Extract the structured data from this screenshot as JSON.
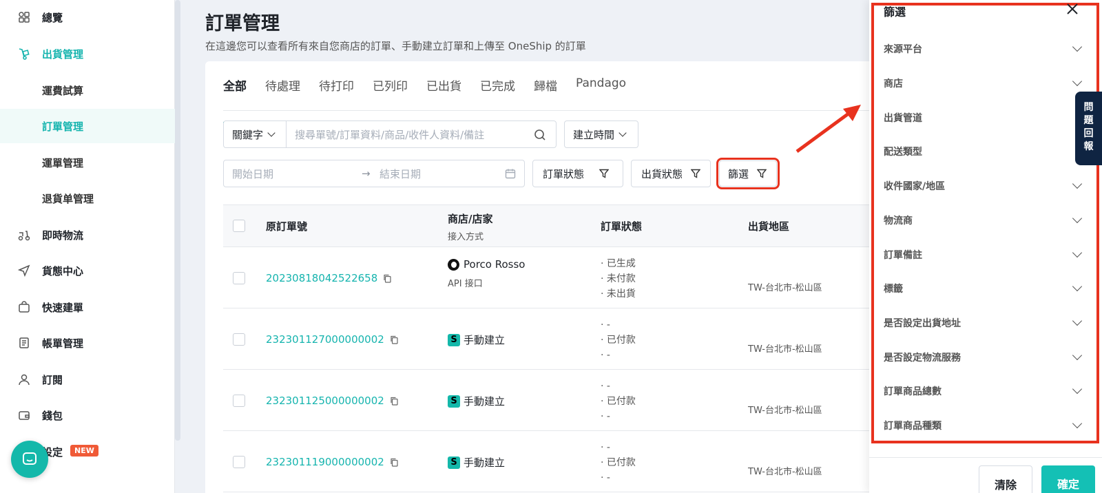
{
  "sidebar": {
    "items": [
      {
        "label": "總覽"
      },
      {
        "label": "出貨管理"
      },
      {
        "label": "運費試算"
      },
      {
        "label": "訂單管理"
      },
      {
        "label": "運單管理"
      },
      {
        "label": "退貨单管理"
      },
      {
        "label": "即時物流"
      },
      {
        "label": "貨態中心"
      },
      {
        "label": "快速建單"
      },
      {
        "label": "帳單管理"
      },
      {
        "label": "訂閱"
      },
      {
        "label": "錢包"
      },
      {
        "label": "設定",
        "badge": "NEW"
      }
    ]
  },
  "main": {
    "title": "訂單管理",
    "subtitle": "在這邊您可以查看所有來自您商店的訂單、手動建立訂單和上傳至 OneShip 的訂單",
    "tabs": [
      "全部",
      "待處理",
      "待打印",
      "已列印",
      "已出貨",
      "已完成",
      "歸檔",
      "Pandago"
    ],
    "filters": {
      "keyword_label": "關鍵字",
      "search_placeholder": "搜尋單號/訂單資料/商品/收件人資料/備註",
      "time_label": "建立時間",
      "start_date_placeholder": "開始日期",
      "end_date_placeholder": "結束日期",
      "order_status_label": "訂單狀態",
      "shipping_status_label": "出貨狀態",
      "filter_label": "篩選"
    },
    "table": {
      "headers": {
        "order_no": "原訂單號",
        "store": "商店/店家",
        "store_sub": "接入方式",
        "order_status": "訂單狀態",
        "region": "出貨地區"
      },
      "rows": [
        {
          "order_no": "20230818042522658",
          "store": "Porco Rosso",
          "access": "API 接口",
          "status": [
            "· 已生成",
            "· 未付款",
            "· 未出貨"
          ],
          "region": "TW-台北市-松山區"
        },
        {
          "order_no": "232301127000000002",
          "store": "手動建立",
          "status": [
            "· -",
            "· 已付款",
            "· -"
          ],
          "region": "TW-台北市-松山區"
        },
        {
          "order_no": "232301125000000002",
          "store": "手動建立",
          "status": [
            "· -",
            "· 已付款",
            "· -"
          ],
          "region": "TW-台北市-松山區"
        },
        {
          "order_no": "232301119000000002",
          "store": "手動建立",
          "status": [
            "· -",
            "· 已付款",
            "· -"
          ],
          "region": "TW-台北市-松山區"
        }
      ]
    }
  },
  "panel": {
    "title": "篩選",
    "items": [
      "來源平台",
      "商店",
      "出貨管道",
      "配送類型",
      "收件國家/地區",
      "物流商",
      "訂單備註",
      "標籤",
      "是否設定出貨地址",
      "是否設定物流服務",
      "訂單商品總數",
      "訂單商品種類"
    ],
    "clear_label": "清除",
    "confirm_label": "確定"
  },
  "help_tab": "問題回報",
  "colors": {
    "accent": "#15b4ae",
    "highlight": "#e8321e",
    "help_bg": "#0f2442"
  }
}
